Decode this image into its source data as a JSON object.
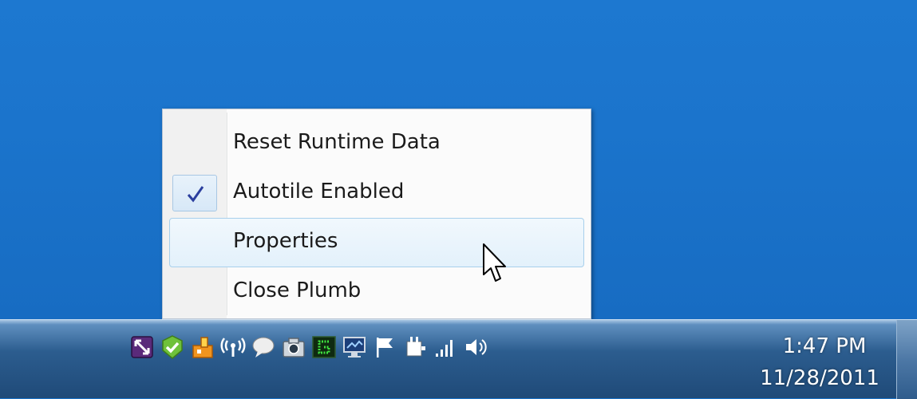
{
  "context_menu": {
    "items": [
      {
        "label": "Reset Runtime Data",
        "checked": false,
        "highlighted": false
      },
      {
        "label": "Autotile Enabled",
        "checked": true,
        "highlighted": false
      },
      {
        "label": "Properties",
        "checked": false,
        "highlighted": true
      },
      {
        "label": "Close Plumb",
        "checked": false,
        "highlighted": false
      }
    ]
  },
  "taskbar": {
    "tray_icons": [
      "resize-app-icon",
      "green-check-app-icon",
      "orange-app-icon",
      "wireless-icon",
      "chat-bubble-icon",
      "camera-icon",
      "green-monitor-icon",
      "display-icon",
      "action-center-flag-icon",
      "power-plug-icon",
      "signal-bars-icon",
      "volume-icon"
    ],
    "clock": {
      "time": "1:47 PM",
      "date": "11/28/2011"
    }
  },
  "colors": {
    "desktop": "#1b74cc",
    "highlight_border": "#a8d0ec",
    "check": "#2b3f9e"
  }
}
